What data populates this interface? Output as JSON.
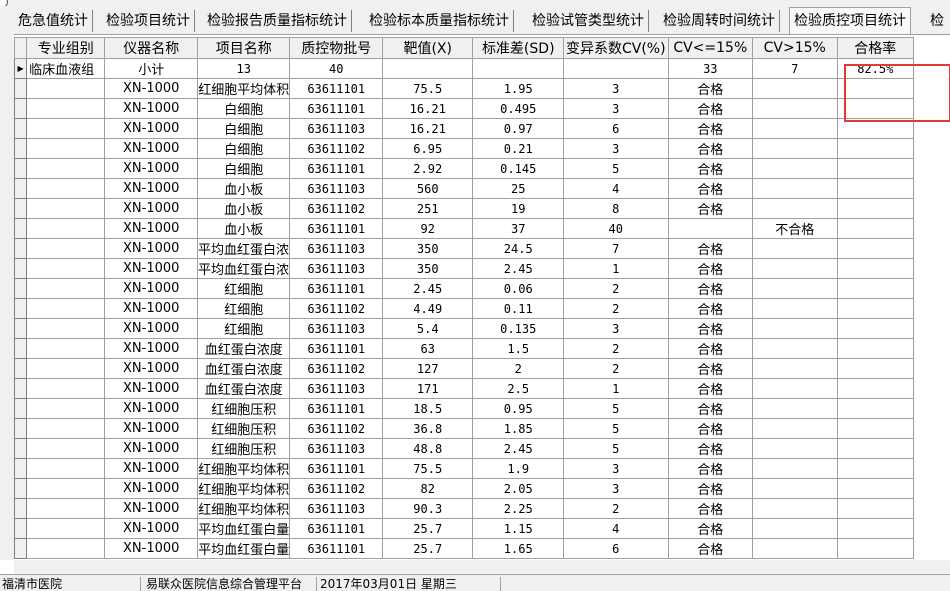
{
  "tabs": [
    {
      "label": "危急值统计",
      "active": false
    },
    {
      "label": "检验项目统计",
      "active": false
    },
    {
      "label": "检验报告质量指标统计",
      "active": false
    },
    {
      "label": "检验标本质量指标统计",
      "active": false
    },
    {
      "label": "检验试管类型统计",
      "active": false
    },
    {
      "label": "检验周转时间统计",
      "active": false
    },
    {
      "label": "检验质控项目统计",
      "active": true
    },
    {
      "label": "检",
      "active": false
    }
  ],
  "columns": [
    "专业组别",
    "仪器名称",
    "项目名称",
    "质控物批号",
    "靶值(X)",
    "标准差(SD)",
    "变异系数CV(%)",
    "CV<=15%",
    "CV>15%",
    "合格率"
  ],
  "summary_row": {
    "indicator": "▶",
    "group": "临床血液组",
    "instrument": "小计",
    "item": "13",
    "lot": "40",
    "target": "",
    "sd": "",
    "cv": "",
    "cv_le15": "33",
    "cv_gt15": "7",
    "pass_rate": "82.5%"
  },
  "rows": [
    [
      "",
      "XN-1000",
      "红细胞平均体积",
      "63611101",
      "75.5",
      "1.95",
      "3",
      "合格",
      "",
      ""
    ],
    [
      "",
      "XN-1000",
      "白细胞",
      "63611101",
      "16.21",
      "0.495",
      "3",
      "合格",
      "",
      ""
    ],
    [
      "",
      "XN-1000",
      "白细胞",
      "63611103",
      "16.21",
      "0.97",
      "6",
      "合格",
      "",
      ""
    ],
    [
      "",
      "XN-1000",
      "白细胞",
      "63611102",
      "6.95",
      "0.21",
      "3",
      "合格",
      "",
      ""
    ],
    [
      "",
      "XN-1000",
      "白细胞",
      "63611101",
      "2.92",
      "0.145",
      "5",
      "合格",
      "",
      ""
    ],
    [
      "",
      "XN-1000",
      "血小板",
      "63611103",
      "560",
      "25",
      "4",
      "合格",
      "",
      ""
    ],
    [
      "",
      "XN-1000",
      "血小板",
      "63611102",
      "251",
      "19",
      "8",
      "合格",
      "",
      ""
    ],
    [
      "",
      "XN-1000",
      "血小板",
      "63611101",
      "92",
      "37",
      "40",
      "",
      "不合格",
      ""
    ],
    [
      "",
      "XN-1000",
      "平均血红蛋白浓度",
      "63611103",
      "350",
      "24.5",
      "7",
      "合格",
      "",
      ""
    ],
    [
      "",
      "XN-1000",
      "平均血红蛋白浓度",
      "63611103",
      "350",
      "2.45",
      "1",
      "合格",
      "",
      ""
    ],
    [
      "",
      "XN-1000",
      "红细胞",
      "63611101",
      "2.45",
      "0.06",
      "2",
      "合格",
      "",
      ""
    ],
    [
      "",
      "XN-1000",
      "红细胞",
      "63611102",
      "4.49",
      "0.11",
      "2",
      "合格",
      "",
      ""
    ],
    [
      "",
      "XN-1000",
      "红细胞",
      "63611103",
      "5.4",
      "0.135",
      "3",
      "合格",
      "",
      ""
    ],
    [
      "",
      "XN-1000",
      "血红蛋白浓度",
      "63611101",
      "63",
      "1.5",
      "2",
      "合格",
      "",
      ""
    ],
    [
      "",
      "XN-1000",
      "血红蛋白浓度",
      "63611102",
      "127",
      "2",
      "2",
      "合格",
      "",
      ""
    ],
    [
      "",
      "XN-1000",
      "血红蛋白浓度",
      "63611103",
      "171",
      "2.5",
      "1",
      "合格",
      "",
      ""
    ],
    [
      "",
      "XN-1000",
      "红细胞压积",
      "63611101",
      "18.5",
      "0.95",
      "5",
      "合格",
      "",
      ""
    ],
    [
      "",
      "XN-1000",
      "红细胞压积",
      "63611102",
      "36.8",
      "1.85",
      "5",
      "合格",
      "",
      ""
    ],
    [
      "",
      "XN-1000",
      "红细胞压积",
      "63611103",
      "48.8",
      "2.45",
      "5",
      "合格",
      "",
      ""
    ],
    [
      "",
      "XN-1000",
      "红细胞平均体积",
      "63611101",
      "75.5",
      "1.9",
      "3",
      "合格",
      "",
      ""
    ],
    [
      "",
      "XN-1000",
      "红细胞平均体积",
      "63611102",
      "82",
      "2.05",
      "3",
      "合格",
      "",
      ""
    ],
    [
      "",
      "XN-1000",
      "红细胞平均体积",
      "63611103",
      "90.3",
      "2.25",
      "2",
      "合格",
      "",
      ""
    ],
    [
      "",
      "XN-1000",
      "平均血红蛋白量",
      "63611101",
      "25.7",
      "1.15",
      "4",
      "合格",
      "",
      ""
    ],
    [
      "",
      "XN-1000",
      "平均血红蛋白量",
      "63611101",
      "25.7",
      "1.65",
      "6",
      "合格",
      "",
      ""
    ]
  ],
  "status": {
    "hospital": "福清市医院",
    "platform": "易联众医院信息综合管理平台",
    "date": "2017年03月01日 星期三"
  },
  "colors": {
    "highlight": "#e53935",
    "chrome": "#f0f0f0",
    "grid_line": "#a0a0a0"
  }
}
